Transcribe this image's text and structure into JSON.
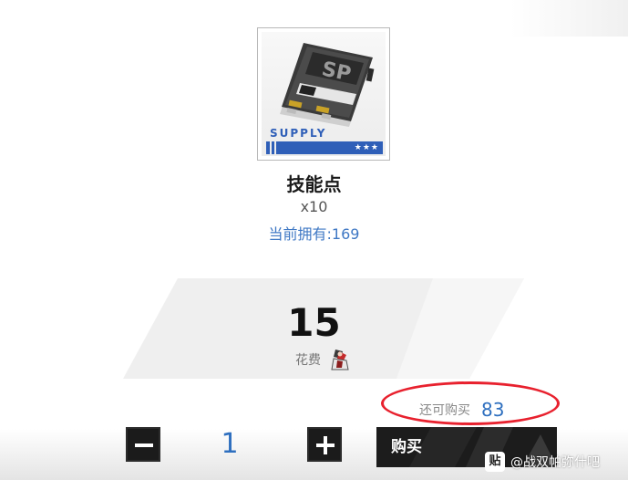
{
  "item": {
    "supply_label": "SUPPLY",
    "stars": "★★★",
    "name": "技能点",
    "quantity": "x10",
    "owned": "当前拥有:169"
  },
  "price": {
    "value": "15",
    "cost_label": "花费",
    "currency_icon": "currency-figure-icon"
  },
  "remaining": {
    "label": "还可购买",
    "value": "83"
  },
  "purchase": {
    "quantity": "1",
    "buy_label": "购买"
  },
  "watermark": {
    "logo": "贴",
    "text": "@战双帕弥什吧"
  },
  "colors": {
    "accent_blue": "#2e6fbf",
    "highlight_red": "#e8212e",
    "button_dark": "#1c1c1c"
  }
}
